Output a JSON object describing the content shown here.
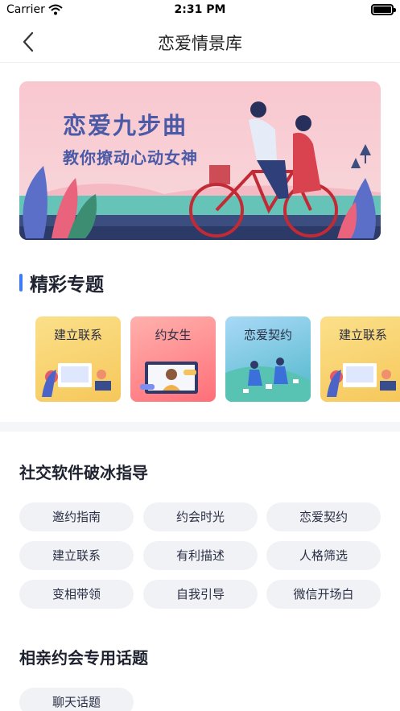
{
  "status_bar": {
    "carrier": "Carrier",
    "time": "2:31 PM"
  },
  "nav": {
    "title": "恋爱情景库"
  },
  "banner": {
    "title": "恋爱九步曲",
    "subtitle": "教你撩动心动女神"
  },
  "featured": {
    "title": "精彩专题",
    "cards": [
      {
        "label": "建立联系"
      },
      {
        "label": "约女生"
      },
      {
        "label": "恋爱契约"
      },
      {
        "label": "建立联系"
      }
    ]
  },
  "icebreaker": {
    "title": "社交软件破冰指导",
    "tags": [
      "邀约指南",
      "约会时光",
      "恋爱契约",
      "建立联系",
      "有利描述",
      "人格筛选",
      "变相带领",
      "自我引导",
      "微信开场白"
    ]
  },
  "blind_date": {
    "title": "相亲约会专用话题",
    "tags": [
      "聊天话题"
    ]
  },
  "colors": {
    "accent": "#3f7bf6",
    "banner_text": "#4a5aa6",
    "tag_bg": "#f1f2f5"
  }
}
